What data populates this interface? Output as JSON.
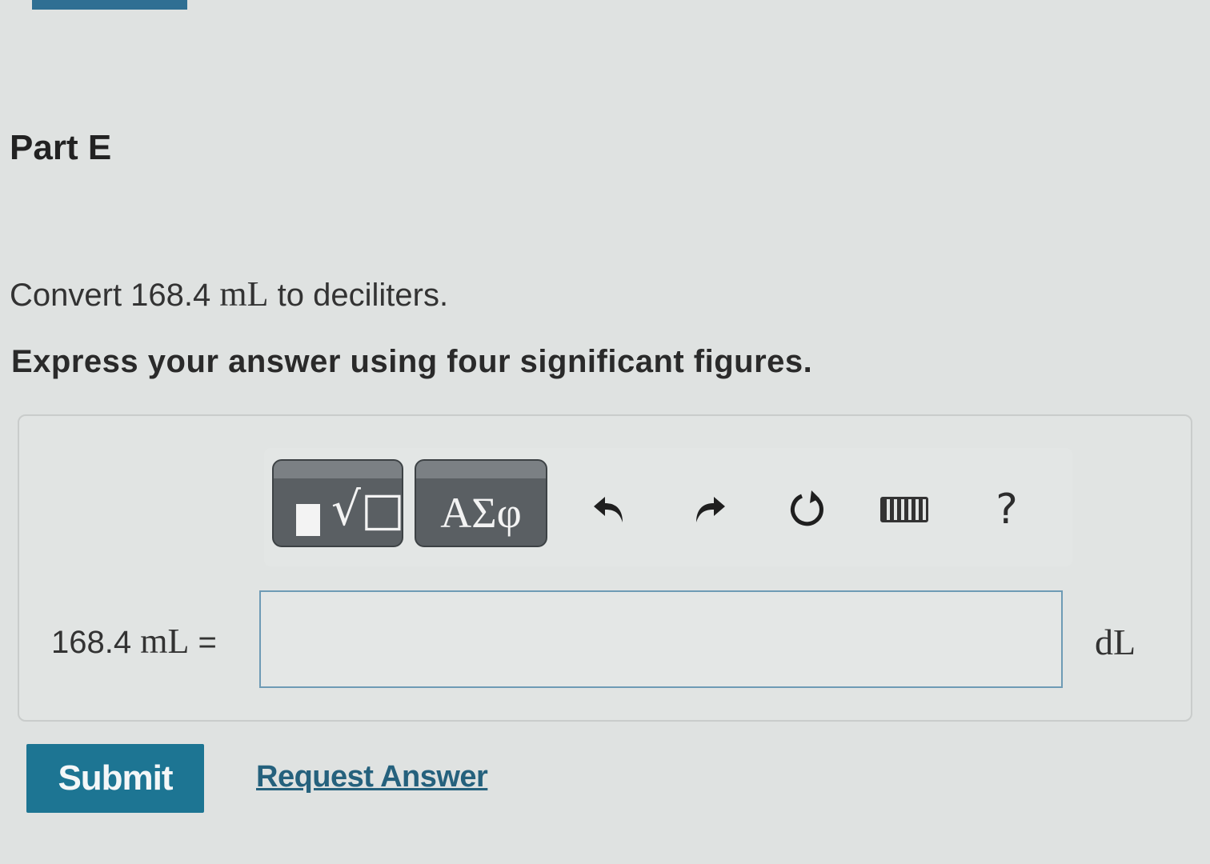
{
  "part": {
    "title": "Part E"
  },
  "question": {
    "prefix": "Convert 168.4",
    "unit": "mL",
    "suffix": "to deciliters."
  },
  "instruction": "Express your answer using four significant figures.",
  "toolbar": {
    "symbols_label": "ΑΣφ",
    "help_label": "?",
    "icons": [
      "templates-icon",
      "symbols-icon",
      "undo-icon",
      "redo-icon",
      "reset-icon",
      "keyboard-icon",
      "help-icon"
    ]
  },
  "answer": {
    "left_value": "168.4",
    "left_unit": "mL",
    "equals": "=",
    "input_value": "",
    "unit": "dL"
  },
  "actions": {
    "submit_label": "Submit",
    "request_label": "Request Answer"
  },
  "colors": {
    "accent": "#1d7593",
    "link": "#25617d",
    "input_border": "#6e9bb5"
  }
}
